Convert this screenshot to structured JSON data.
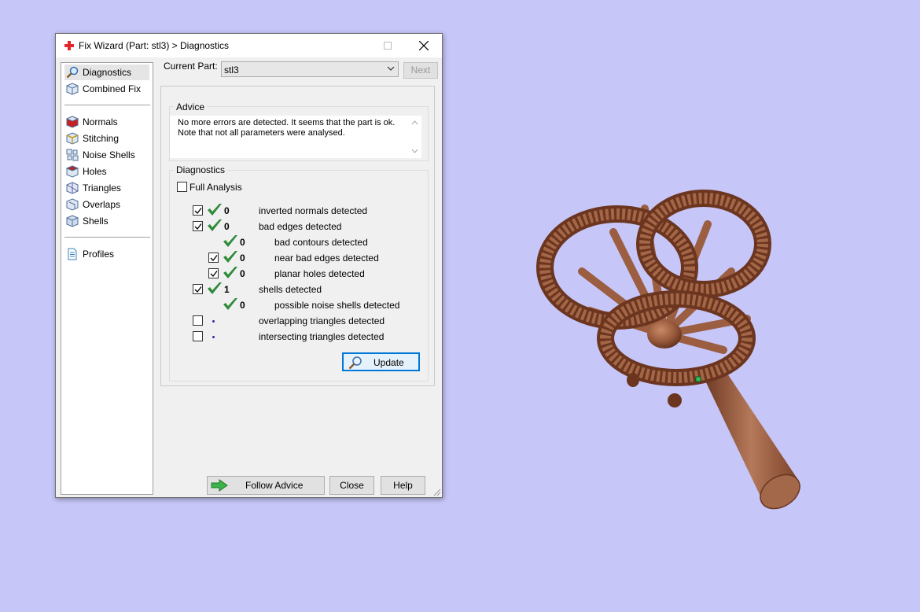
{
  "window": {
    "title": "Fix Wizard (Part: stl3) > Diagnostics"
  },
  "sidebar": {
    "items": [
      {
        "label": "Diagnostics",
        "icon": "magnifier-icon",
        "selected": true
      },
      {
        "label": "Combined Fix",
        "icon": "cube-icon"
      },
      {
        "label": "Normals",
        "icon": "normals-cube-icon"
      },
      {
        "label": "Stitching",
        "icon": "stitching-cube-icon"
      },
      {
        "label": "Noise Shells",
        "icon": "noise-shells-icon"
      },
      {
        "label": "Holes",
        "icon": "holes-cube-icon"
      },
      {
        "label": "Triangles",
        "icon": "triangles-cube-icon"
      },
      {
        "label": "Overlaps",
        "icon": "overlaps-cube-icon"
      },
      {
        "label": "Shells",
        "icon": "shells-cube-icon"
      },
      {
        "label": "Profiles",
        "icon": "document-icon"
      }
    ]
  },
  "header": {
    "current_part_label": "Current Part:",
    "current_part_value": "stl3",
    "next_label": "Next"
  },
  "advice": {
    "legend": "Advice",
    "text_line1": "No more errors are detected. It seems that the part is ok.",
    "text_line2": "Note that not all parameters were analysed."
  },
  "diagnostics": {
    "legend": "Diagnostics",
    "full_analysis_label": "Full Analysis",
    "full_analysis_checked": false,
    "rows": [
      {
        "count": "0",
        "label": "inverted normals detected",
        "checked": true
      },
      {
        "count": "0",
        "label": "bad edges detected",
        "checked": true
      },
      {
        "count": "0",
        "label": "bad contours detected"
      },
      {
        "count": "0",
        "label": "near bad edges detected",
        "checked": true
      },
      {
        "count": "0",
        "label": "planar holes detected",
        "checked": true
      },
      {
        "count": "1",
        "label": "shells detected",
        "checked": true
      },
      {
        "count": "0",
        "label": "possible noise shells detected"
      },
      {
        "label": "overlapping triangles detected",
        "checked": false
      },
      {
        "label": "intersecting triangles detected",
        "checked": false
      }
    ],
    "update_label": "Update"
  },
  "footer": {
    "follow_label": "Follow Advice",
    "close_label": "Close",
    "help_label": "Help"
  },
  "colors": {
    "background": "#c6c6f8",
    "model": "#9a5a3c",
    "check_green": "#2e8b3a",
    "selection": "#0078d7"
  }
}
